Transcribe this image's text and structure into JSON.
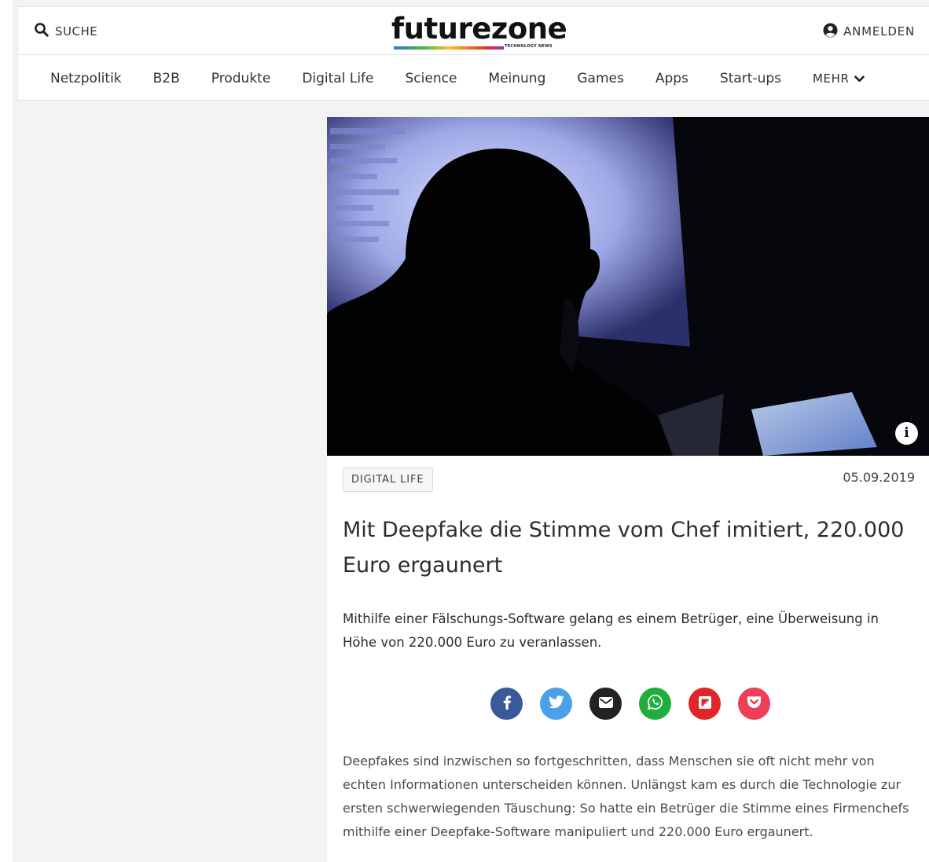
{
  "header": {
    "search_label": "SUCHE",
    "logo_text": "futurezone",
    "logo_tagline": "TECHNOLOGY NEWS",
    "login_label": "ANMELDEN"
  },
  "nav": {
    "items": [
      "Netzpolitik",
      "B2B",
      "Produkte",
      "Digital Life",
      "Science",
      "Meinung",
      "Games",
      "Apps",
      "Start-ups"
    ],
    "more_label": "MEHR"
  },
  "article": {
    "category": "DIGITAL LIFE",
    "date": "05.09.2019",
    "headline": "Mit Deepfake die Stimme vom Chef imitiert, 220.000 Euro ergaunert",
    "lead": "Mithilfe einer Fälschungs-Software gelang es einem Betrüger, eine Überweisung in Höhe von 220.000 Euro zu veranlassen.",
    "body": "Deepfakes sind inzwischen so fortgeschritten, dass Menschen sie oft nicht mehr von echten Informationen unterscheiden können. Unlängst kam es durch die Technologie zur ersten schwerwiegenden Täuschung: So hatte ein Betrüger die Stimme eines Firmenchefs mithilfe einer Deepfake-Software manipuliert und 220.000 Euro ergaunert."
  },
  "share": [
    {
      "name": "facebook",
      "color": "#3b5998"
    },
    {
      "name": "twitter",
      "color": "#4aa1e8"
    },
    {
      "name": "email",
      "color": "#222222"
    },
    {
      "name": "whatsapp",
      "color": "#1fae3e"
    },
    {
      "name": "flipboard",
      "color": "#e0262b"
    },
    {
      "name": "pocket",
      "color": "#ef3f56"
    }
  ]
}
